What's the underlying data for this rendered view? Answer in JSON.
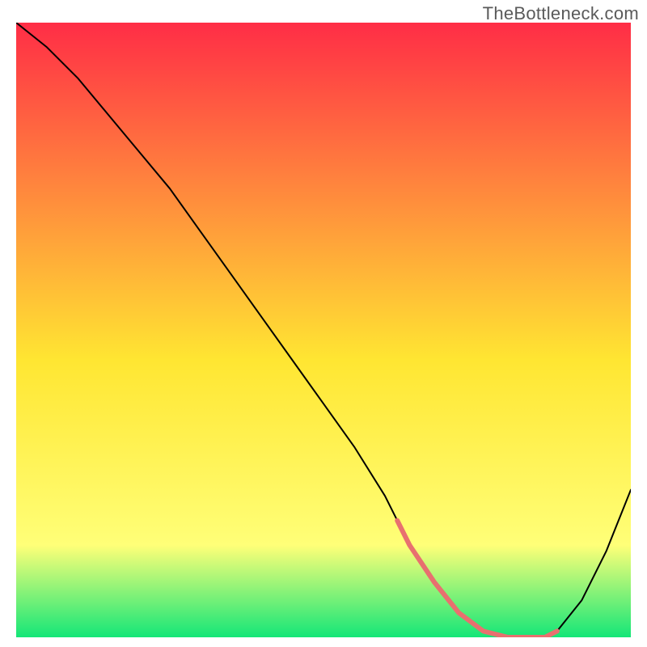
{
  "watermark": "TheBottleneck.com",
  "chart_data": {
    "type": "line",
    "title": "",
    "xlabel": "",
    "ylabel": "",
    "xlim": [
      0,
      100
    ],
    "ylim": [
      0,
      100
    ],
    "grid": false,
    "background_gradient": {
      "top_rgb": [
        255,
        45,
        70
      ],
      "upper_mid_rgb": [
        255,
        145,
        60
      ],
      "mid_rgb": [
        255,
        230,
        50
      ],
      "lower_mid_rgb": [
        255,
        255,
        120
      ],
      "bottom_rgb": [
        20,
        230,
        120
      ]
    },
    "series": [
      {
        "name": "bottleneck-curve",
        "color": "#000000",
        "width": 2,
        "x": [
          0,
          5,
          10,
          15,
          20,
          25,
          30,
          35,
          40,
          45,
          50,
          55,
          60,
          62,
          64,
          68,
          72,
          76,
          80,
          82,
          84,
          86,
          88,
          92,
          96,
          100
        ],
        "y": [
          100,
          96,
          91,
          85,
          79,
          73,
          66,
          59,
          52,
          45,
          38,
          31,
          23,
          19,
          15,
          9,
          4,
          1,
          0,
          0,
          0,
          0,
          1,
          6,
          14,
          24
        ]
      },
      {
        "name": "sweet-spot-band",
        "color": "#e8706f",
        "width": 6,
        "x": [
          62,
          64,
          68,
          72,
          76,
          80,
          82,
          84,
          86,
          88
        ],
        "y": [
          19,
          15,
          9,
          4,
          1,
          0,
          0,
          0,
          0,
          1
        ]
      }
    ]
  }
}
